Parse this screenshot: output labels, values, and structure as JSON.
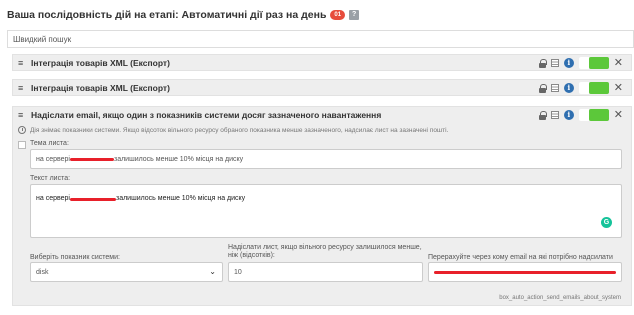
{
  "header": {
    "title": "Ваша послідовність дій на етапі: Автоматичні дії раз на день",
    "badge": "01",
    "help": "?"
  },
  "search": {
    "placeholder": "Швидкий пошук"
  },
  "actions": [
    {
      "title": "Інтеграція товарів XML (Експорт)",
      "enabled": true
    },
    {
      "title": "Інтеграція товарів XML (Експорт)",
      "enabled": true
    },
    {
      "title": "Надіслати email, якщо один з показників системи досяг зазначеного навантаження",
      "enabled": true,
      "description": "Дія знімає показники системи. Якщо відсоток вільного ресурсу обраного показника менше зазначеного, надсилає лист на зазначені пошті.",
      "subject_label": "Тема листа:",
      "subject_prefix": "на сервері",
      "subject_suffix": "залишилось менше 10% місця на диску",
      "body_label": "Текст листа:",
      "body_prefix": "на сервері",
      "body_suffix": "залишилось менше 10% місця на диску",
      "metric_label": "Виберіть показник системи:",
      "metric_value": "disk",
      "threshold_label": "Надіслати лист, якщо вільного ресурсу залишилося менше, ніж (відсотків):",
      "threshold_value": "10",
      "emails_label": "Перерахуйте через кому email на які потрібно надсилати лист:",
      "code": "box_auto_action_send_emails_about_system"
    }
  ],
  "icons": {
    "drag": "≡",
    "info": "i",
    "close": "✕",
    "chevron": "⌄",
    "grammarly": "G"
  },
  "colors": {
    "toggle_on": "#5cc83a",
    "badge": "#e74c3c",
    "info": "#2f6fb0",
    "redaction": "#e8202a"
  }
}
